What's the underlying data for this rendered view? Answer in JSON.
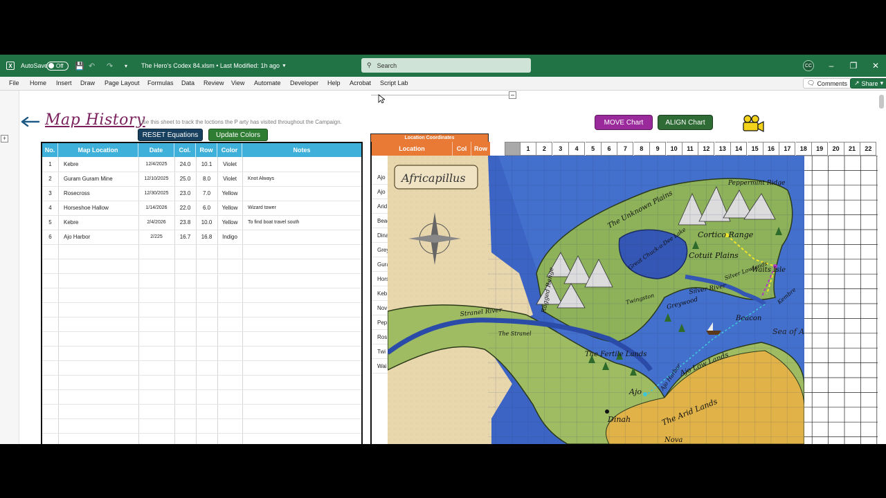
{
  "titlebar": {
    "autosave_label": "AutoSave",
    "autosave_state": "Off",
    "file_title": "The Hero's Codex 84.xlsm • Last Modified: 1h ago",
    "search_placeholder": "Search",
    "avatar_initials": "CC"
  },
  "menu": {
    "items": [
      "File",
      "Home",
      "Insert",
      "Draw",
      "Page Layout",
      "Formulas",
      "Data",
      "Review",
      "View",
      "Automate",
      "Developer",
      "Help",
      "Acrobat",
      "Script Lab"
    ],
    "comments_label": "Comments",
    "share_label": "Share"
  },
  "sheet": {
    "title": "Map History",
    "instructions": "Use this sheet to track the loctions the P arty has visited throughout the Campaign.",
    "reset_button": "RESET Equations",
    "update_button": "Update Colors",
    "move_button": "MOVE Chart",
    "align_button": "ALIGN Chart"
  },
  "history": {
    "headers": [
      "No.",
      "Map Location",
      "Date",
      "Col.",
      "Row",
      "Color",
      "Notes"
    ],
    "rows": [
      {
        "no": "1",
        "location": "Kebre",
        "date": "12/4/2025",
        "col": "24.0",
        "row": "10.1",
        "color": "Violet",
        "notes": ""
      },
      {
        "no": "2",
        "location": "Guram Guram Mine",
        "date": "12/10/2025",
        "col": "25.0",
        "row": "8.0",
        "color": "Violet",
        "notes": "Knot Always"
      },
      {
        "no": "3",
        "location": "Rosecross",
        "date": "12/30/2025",
        "col": "23.0",
        "row": "7.0",
        "color": "Yellow",
        "notes": ""
      },
      {
        "no": "4",
        "location": "Horseshoe Hallow",
        "date": "1/14/2026",
        "col": "22.0",
        "row": "6.0",
        "color": "Yellow",
        "notes": "Wizard tower"
      },
      {
        "no": "5",
        "location": "Kebre",
        "date": "2/4/2026",
        "col": "23.8",
        "row": "10.0",
        "color": "Yellow",
        "notes": "To find boat travel south"
      },
      {
        "no": "6",
        "location": "Ajo Harbor",
        "date": "2/225",
        "col": "16.7",
        "row": "16.8",
        "color": "Indigo",
        "notes": ""
      }
    ]
  },
  "location_coords": {
    "banner": "Location Coordinates",
    "headers": [
      "Location",
      "Col",
      "Row"
    ],
    "visible_names": [
      "Ajo",
      "Ajo",
      "Arid",
      "Beac",
      "Dina",
      "Grey",
      "Gura",
      "Hors",
      "Keb",
      "Nov",
      "Pep",
      "Ros",
      "Twi",
      "Wai"
    ]
  },
  "grid": {
    "columns": [
      "1",
      "2",
      "3",
      "4",
      "5",
      "6",
      "7",
      "8",
      "9",
      "10",
      "11",
      "12",
      "13",
      "14",
      "15",
      "16",
      "17",
      "18",
      "19",
      "20",
      "21",
      "22"
    ]
  },
  "map": {
    "title": "Africapillus",
    "labels": {
      "peppermint": "Peppermint Ridge",
      "unknown_plains": "The Unknown Plains",
      "cortico": "Cortico Range",
      "cotuit": "Cotuit Plains",
      "waits": "Waits Isle",
      "chuck_lake": "Great Chuck-a-Dee Lake",
      "ragged": "Ragged Range",
      "twingston": "Twingston",
      "greywood": "Greywood",
      "silver_river": "Silver River",
      "silver_lowlands": "Silver Lowlands",
      "kembre": "Kembre",
      "beacon": "Beacon",
      "sea_artos": "Sea of Artos",
      "strane_river": "Stranel River",
      "the_strane": "The Stranel",
      "fertile": "The Fertile Lands",
      "ajo": "Ajo",
      "ajo_harbor": "Ajo Harbor",
      "ajo_low": "Ajo Low Lands",
      "arid": "The Arid Lands",
      "dinah": "Dinah",
      "nova": "Nova"
    }
  },
  "colors": {
    "excel_green": "#217346",
    "header_blue": "#3fb0d9",
    "location_orange": "#e87a36",
    "move_purple": "#9a2a9c",
    "align_green": "#2f6b35"
  }
}
